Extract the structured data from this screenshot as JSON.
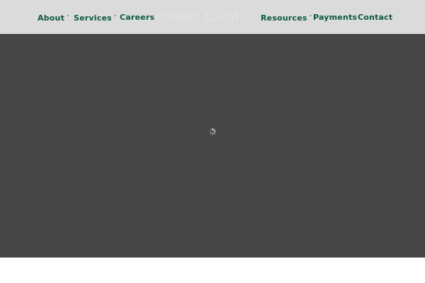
{
  "nav": {
    "left": [
      {
        "label": "About",
        "has_dropdown": true
      },
      {
        "label": "Services",
        "has_dropdown": true
      },
      {
        "label": "Careers",
        "has_dropdown": false
      }
    ],
    "right": [
      {
        "label": "Resources",
        "has_dropdown": true
      },
      {
        "label": "Payments",
        "has_dropdown": false
      },
      {
        "label": "Contact",
        "has_dropdown": false
      }
    ],
    "dropdown_glyph": "˅"
  },
  "logo": {
    "text": "Gilbert Lloyd"
  },
  "hero": {
    "state": "loading",
    "loader_icon": "spinner-icon"
  },
  "colors": {
    "header_bg": "#dbdbdb",
    "nav_text": "#0b5a3c",
    "hero_bg": "#464646",
    "page_bg": "#ffffff"
  }
}
